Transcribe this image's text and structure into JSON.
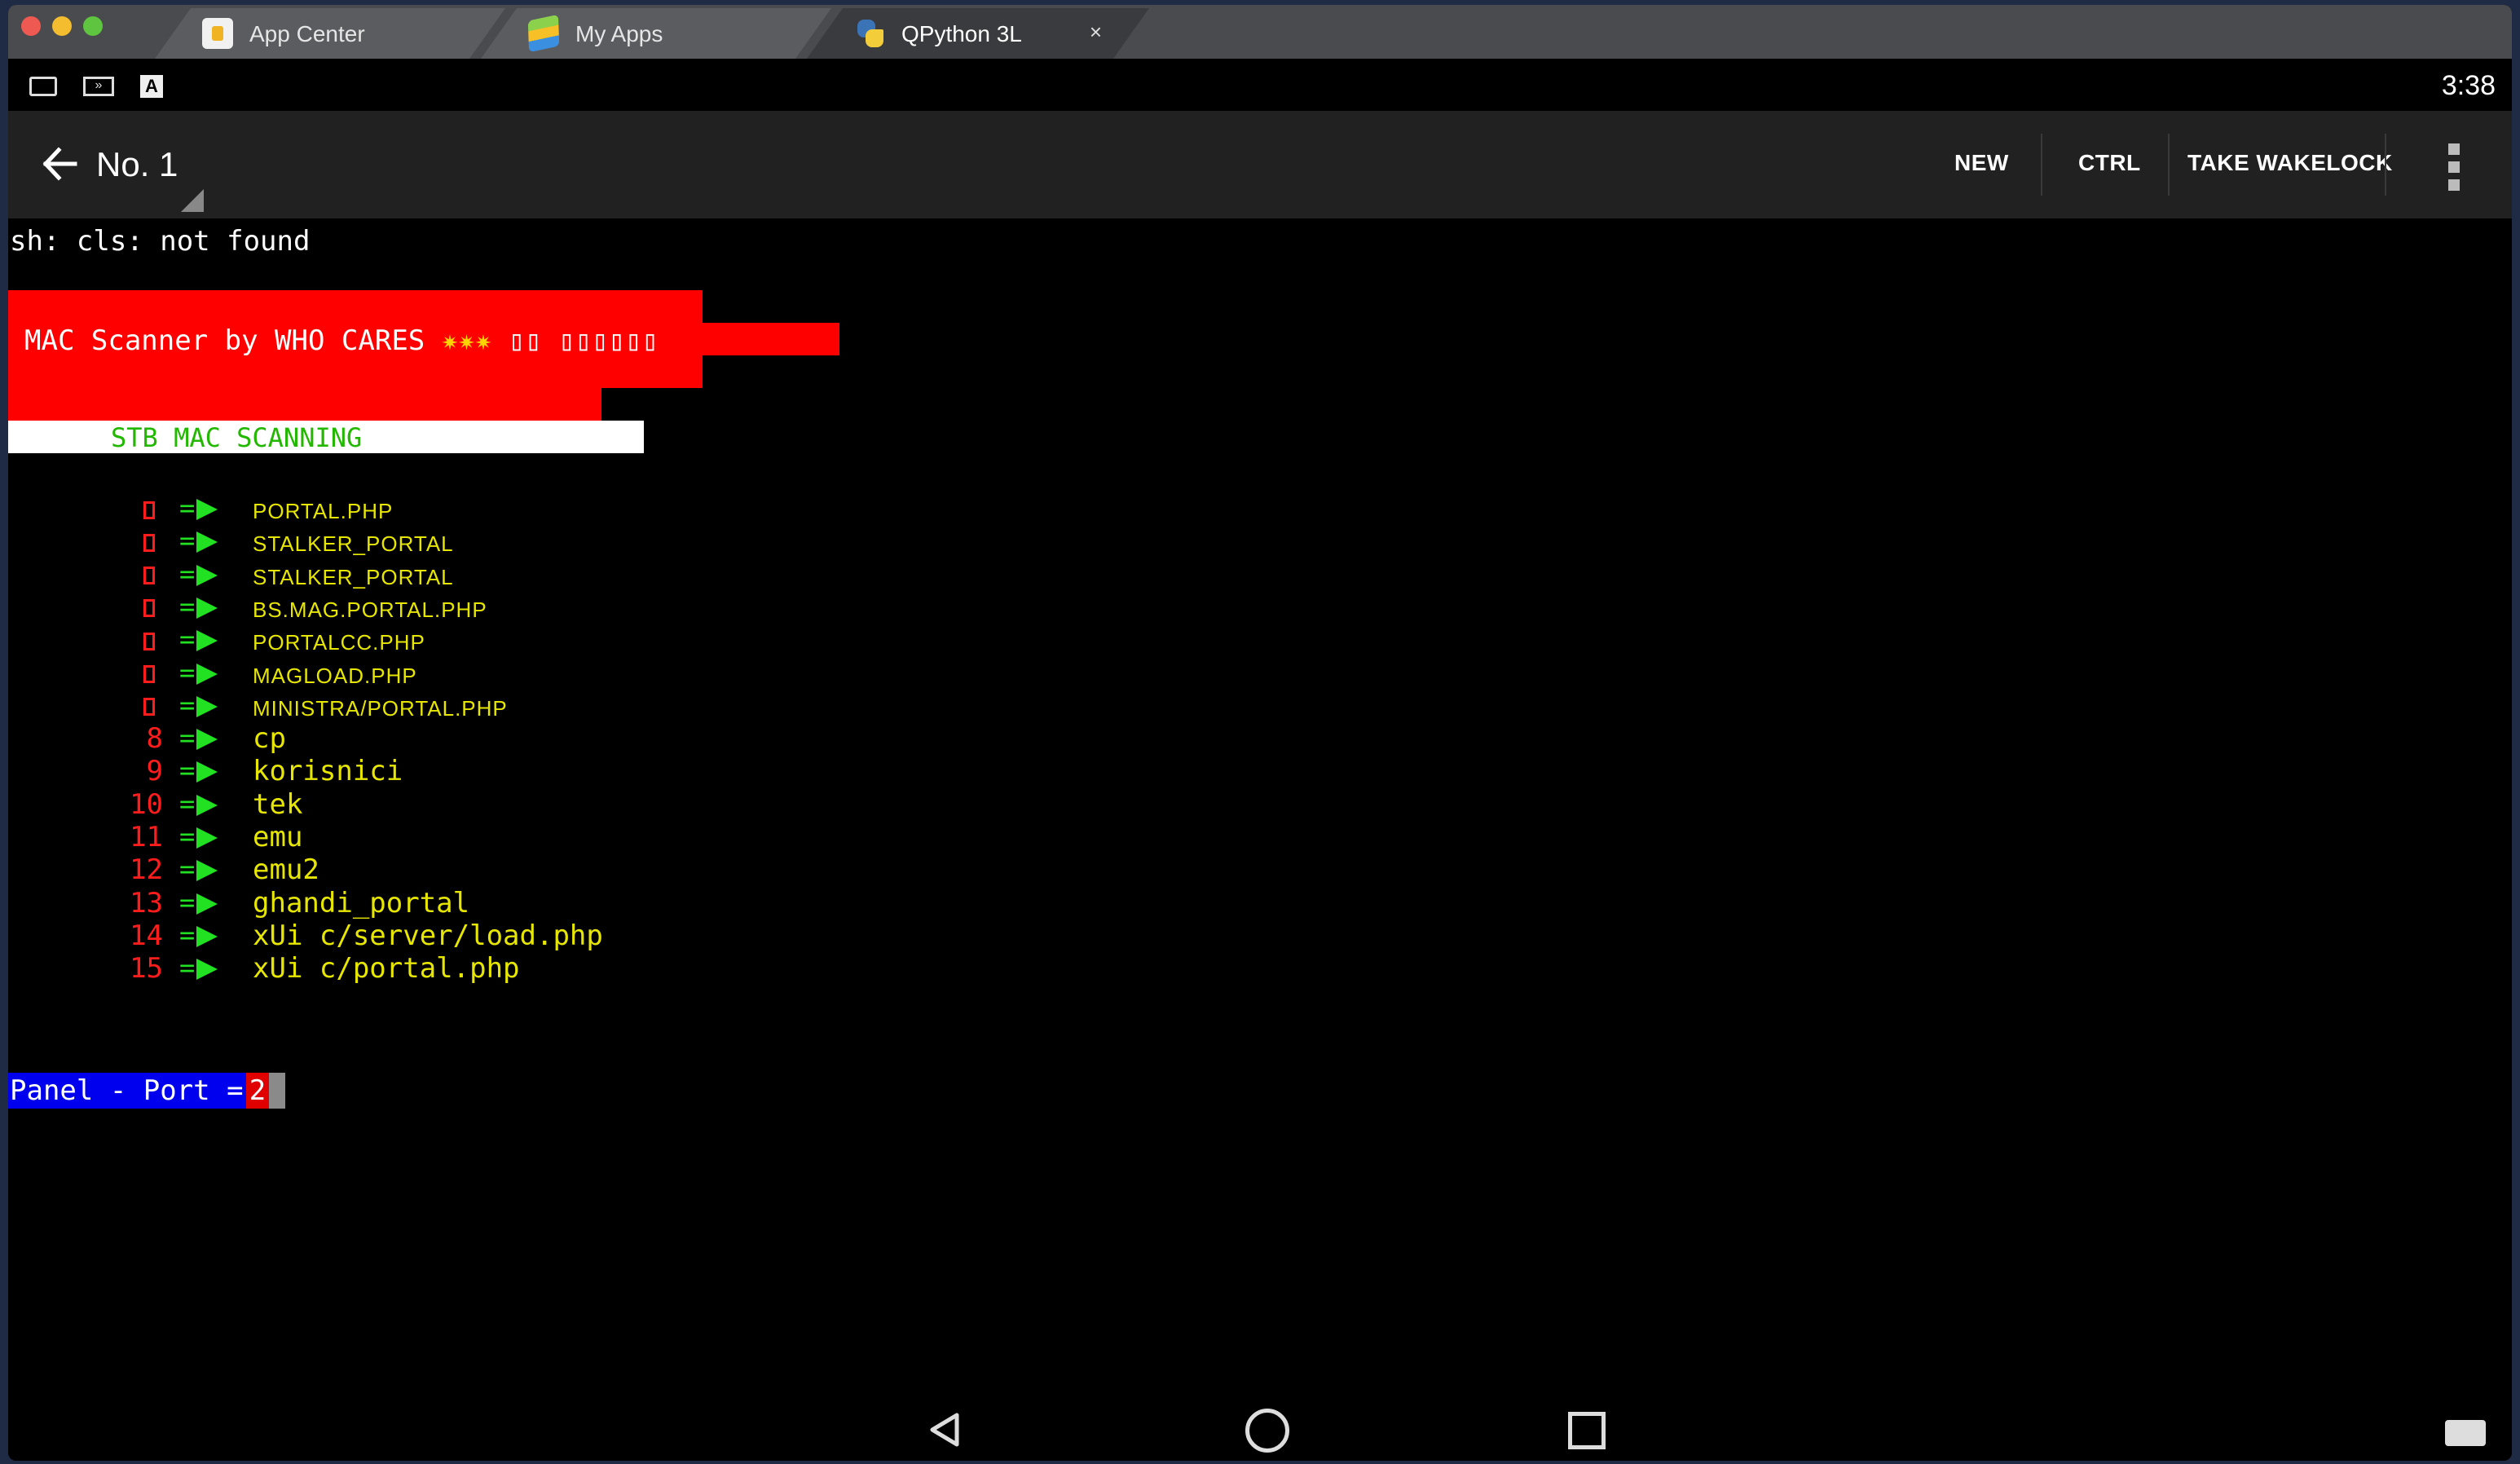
{
  "tabs": [
    {
      "label": "App Center",
      "icon": "app-center-icon"
    },
    {
      "label": "My Apps",
      "icon": "my-apps-icon"
    },
    {
      "label": "QPython 3L",
      "icon": "qpython-icon",
      "active": true,
      "close": "×"
    }
  ],
  "status_bar": {
    "time": "3:38",
    "letter_icon": "A"
  },
  "action_bar": {
    "title": "No. 1",
    "buttons": {
      "new": "NEW",
      "ctrl": "CTRL",
      "wakelock": "TAKE WAKELOCK"
    }
  },
  "terminal": {
    "error_line": "sh: cls: not found",
    "banner_title": "MAC Scanner by WHO CARES",
    "banner_stars": "✷✷✷",
    "banner_garbled": "▯▯ ▯▯▯▯▯▯",
    "scan_header": "STB MAC SCANNING",
    "arrow": "=",
    "menu": [
      {
        "num": "",
        "label": "PORTAL.PHP",
        "small": true
      },
      {
        "num": "",
        "label": "STALKER_PORTAL",
        "small": true
      },
      {
        "num": "",
        "label": "STALKER_PORTAL",
        "small": true
      },
      {
        "num": "",
        "label": "BS.MAG.PORTAL.PHP",
        "small": true
      },
      {
        "num": "",
        "label": "PORTALCC.PHP",
        "small": true
      },
      {
        "num": "",
        "label": "MAGLOAD.PHP",
        "small": true
      },
      {
        "num": "",
        "label": "MINISTRA/PORTAL.PHP",
        "small": true
      },
      {
        "num": "8",
        "label": "cp",
        "small": false
      },
      {
        "num": "9",
        "label": "korisnici",
        "small": false
      },
      {
        "num": "10",
        "label": "tek",
        "small": false
      },
      {
        "num": "11",
        "label": "emu",
        "small": false
      },
      {
        "num": "12",
        "label": "emu2",
        "small": false
      },
      {
        "num": "13",
        "label": "ghandi_portal",
        "small": false
      },
      {
        "num": "14",
        "label": "xUi c/server/load.php",
        "small": false
      },
      {
        "num": "15",
        "label": "xUi c/portal.php",
        "small": false
      }
    ],
    "prompt_label": "Panel - Port =",
    "prompt_value": "2"
  },
  "colors": {
    "banner_red": "#ff0000",
    "menu_number": "#ff1c1c",
    "menu_arrow": "#22e022",
    "menu_label": "#e6e600",
    "prompt_bg": "#0000ee"
  }
}
